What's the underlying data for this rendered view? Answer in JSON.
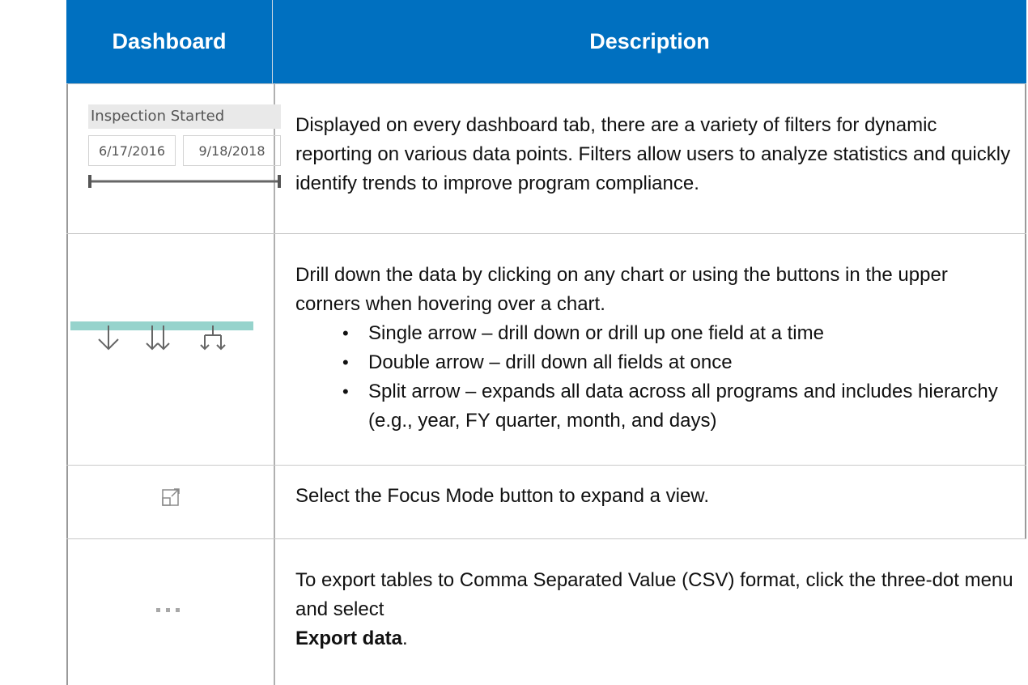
{
  "header": {
    "col1": "Dashboard",
    "col2": "Description"
  },
  "row1": {
    "filter_title": "Inspection Started",
    "date_start": "6/17/2016",
    "date_end": "9/18/2018",
    "description": "Displayed on every dashboard tab, there are a variety of filters for dynamic reporting on various data points. Filters allow users to analyze statistics and quickly identify trends to improve program compliance."
  },
  "row2": {
    "description": "Drill down the data by clicking on any chart or using the buttons in the upper corners when hovering over a chart.",
    "bullets": [
      "Single arrow – drill down or drill up one field at a time",
      "Double arrow – drill down all fields at once",
      "Split arrow – expands all data across all programs and includes hierarchy (e.g., year, FY quarter, month, and days)"
    ],
    "accent_color": "#96d3cc"
  },
  "row3": {
    "description": "Select the Focus Mode button to expand a view."
  },
  "row4": {
    "description": "To export tables to Comma Separated Value (CSV) format, click the three-dot menu and select",
    "bold_text": "Export data",
    "tail": "."
  },
  "colors": {
    "header_bg": "#0070c0",
    "header_text": "#ffffff"
  }
}
